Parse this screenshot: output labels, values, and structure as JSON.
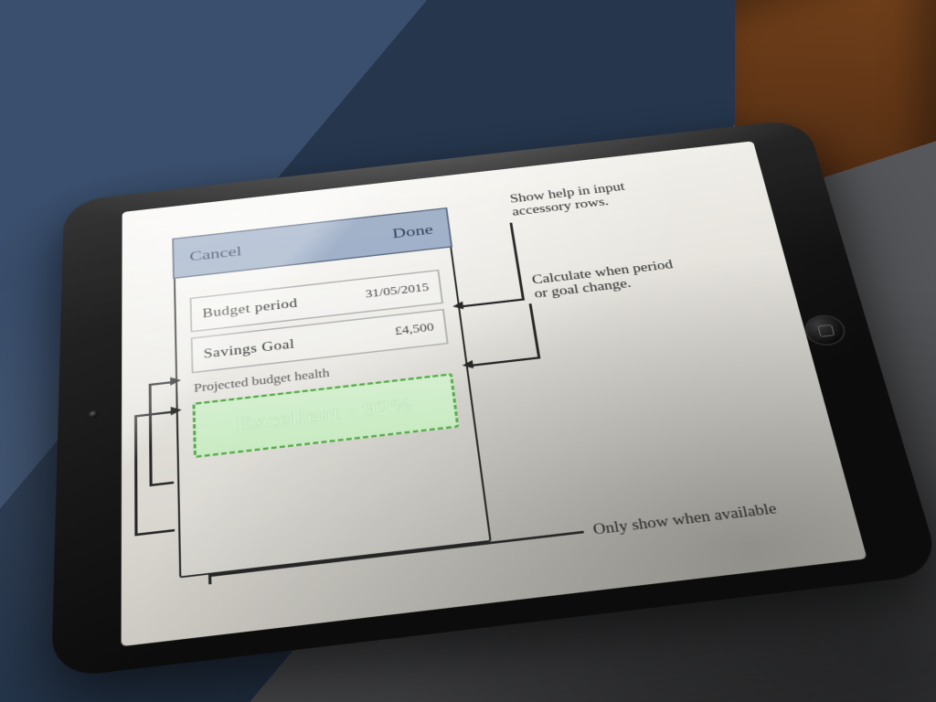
{
  "nav": {
    "cancel": "Cancel",
    "done": "Done"
  },
  "rows": {
    "period": {
      "label": "Budget period",
      "value": "31/05/2015"
    },
    "goal": {
      "label": "Savings Goal",
      "value": "£4,500"
    }
  },
  "section": {
    "health_header": "Projected budget health"
  },
  "health": {
    "status": "Excellent",
    "pct": "92%"
  },
  "notes": {
    "accessory": "Show help in input\naccessory rows.",
    "recalc": "Calculate when period\nor goal change.",
    "availability": "Only show when available"
  }
}
